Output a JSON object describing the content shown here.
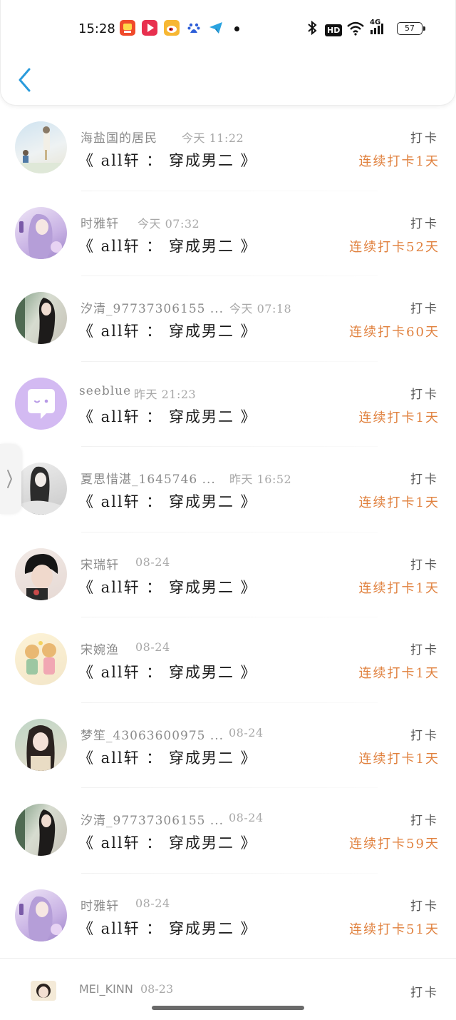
{
  "status_bar": {
    "time": "15:28",
    "network": "4G",
    "hd": "HD",
    "battery": "57",
    "app_icons": [
      "kuaikan-icon",
      "video-player-icon",
      "weibo-icon",
      "baidu-icon",
      "telegram-icon"
    ]
  },
  "header": {
    "back_icon": "chevron-left-icon"
  },
  "checkins": [
    {
      "user": "海盐国的居民",
      "time": "今天 11:22",
      "book": "《 all轩 ： 穿成男二 》",
      "label": "打卡",
      "streak": "连续打卡1天",
      "avatar": "avatar-0"
    },
    {
      "user": "时雅轩",
      "time": "今天 07:32",
      "book": "《 all轩 ： 穿成男二 》",
      "label": "打卡",
      "streak": "连续打卡52天",
      "avatar": "avatar-1"
    },
    {
      "user": "汐清_97737306155 ...",
      "time": "今天 07:18",
      "book": "《 all轩 ： 穿成男二 》",
      "label": "打卡",
      "streak": "连续打卡60天",
      "avatar": "avatar-2"
    },
    {
      "user": "seeblue",
      "time": "昨天 21:23",
      "book": "《 all轩 ： 穿成男二 》",
      "label": "打卡",
      "streak": "连续打卡1天",
      "avatar": "avatar-3"
    },
    {
      "user": "夏思惜湛_1645746 ...",
      "time": "昨天 16:52",
      "book": "《 all轩 ： 穿成男二 》",
      "label": "打卡",
      "streak": "连续打卡1天",
      "avatar": "avatar-4"
    },
    {
      "user": "宋瑞轩",
      "time": "08-24",
      "book": "《 all轩 ： 穿成男二 》",
      "label": "打卡",
      "streak": "连续打卡1天",
      "avatar": "avatar-5"
    },
    {
      "user": "宋婉渔",
      "time": "08-24",
      "book": "《 all轩 ： 穿成男二 》",
      "label": "打卡",
      "streak": "连续打卡1天",
      "avatar": "avatar-6"
    },
    {
      "user": "梦笙_43063600975 ...",
      "time": "08-24",
      "book": "《 all轩 ： 穿成男二 》",
      "label": "打卡",
      "streak": "连续打卡1天",
      "avatar": "avatar-7"
    },
    {
      "user": "汐清_97737306155 ...",
      "time": "08-24",
      "book": "《 all轩 ： 穿成男二 》",
      "label": "打卡",
      "streak": "连续打卡59天",
      "avatar": "avatar-8"
    },
    {
      "user": "时雅轩",
      "time": "08-24",
      "book": "《 all轩 ： 穿成男二 》",
      "label": "打卡",
      "streak": "连续打卡51天",
      "avatar": "avatar-9"
    }
  ],
  "partial_row": {
    "user": "MEI_KINN",
    "time": "08-23",
    "label": "打卡"
  },
  "colors": {
    "streak": "#e0803d",
    "back_icon": "#2a9bdc",
    "meta": "#8a8a8a"
  }
}
